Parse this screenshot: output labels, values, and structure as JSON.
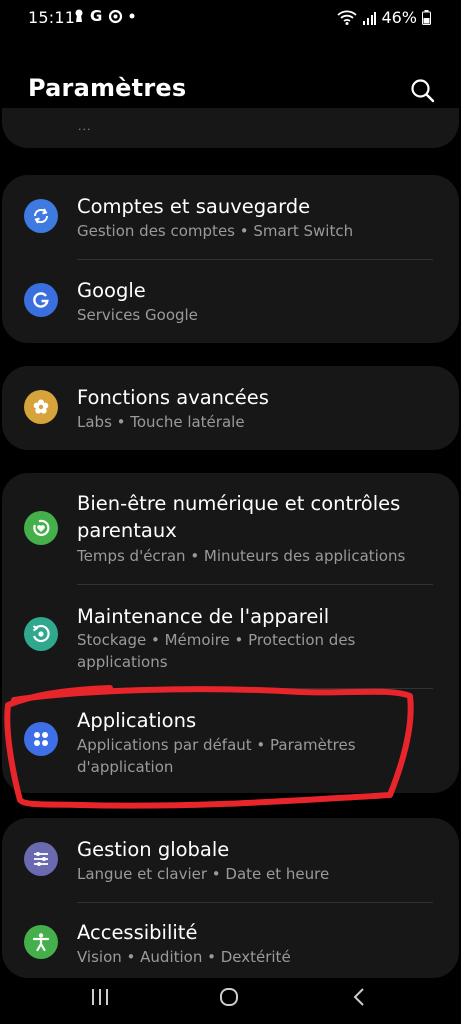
{
  "status_bar": {
    "time": "15:11",
    "battery": "46%"
  },
  "header": {
    "title": "Paramètres"
  },
  "partial_item": {
    "dots": "..."
  },
  "items": [
    {
      "title": "Comptes et sauvegarde",
      "subtitle": "Gestion des comptes  •  Smart Switch",
      "icon": "sync-icon",
      "color": "#3f7ae0"
    },
    {
      "title": "Google",
      "subtitle": "Services Google",
      "icon": "google-icon",
      "color": "#3a6fe0"
    },
    {
      "title": "Fonctions avancées",
      "subtitle": "Labs  •  Touche latérale",
      "icon": "gear-flower-icon",
      "color": "#d7a43c"
    },
    {
      "title_line1": "Bien-être numérique et contrôles",
      "title_line2": "parentaux",
      "subtitle": "Temps d'écran  •  Minuteurs des applications",
      "icon": "heart-circle-icon",
      "color": "#45b04b"
    },
    {
      "title": "Maintenance de l'appareil",
      "subtitle_line1": "Stockage  •  Mémoire  •  Protection des",
      "subtitle_line2": "applications",
      "icon": "maintenance-icon",
      "color": "#2fa88e"
    },
    {
      "title": "Applications",
      "subtitle_line1": "Applications par défaut  •  Paramètres",
      "subtitle_line2": "d'application",
      "icon": "apps-grid-icon",
      "color": "#3f6fe6"
    },
    {
      "title": "Gestion globale",
      "subtitle": "Langue et clavier  •  Date et heure",
      "icon": "sliders-icon",
      "color": "#6a6ab0"
    },
    {
      "title": "Accessibilité",
      "subtitle": "Vision  •  Audition  •  Dextérité",
      "icon": "accessibility-icon",
      "color": "#45b04b"
    }
  ],
  "annotation_color": "#e8252b"
}
